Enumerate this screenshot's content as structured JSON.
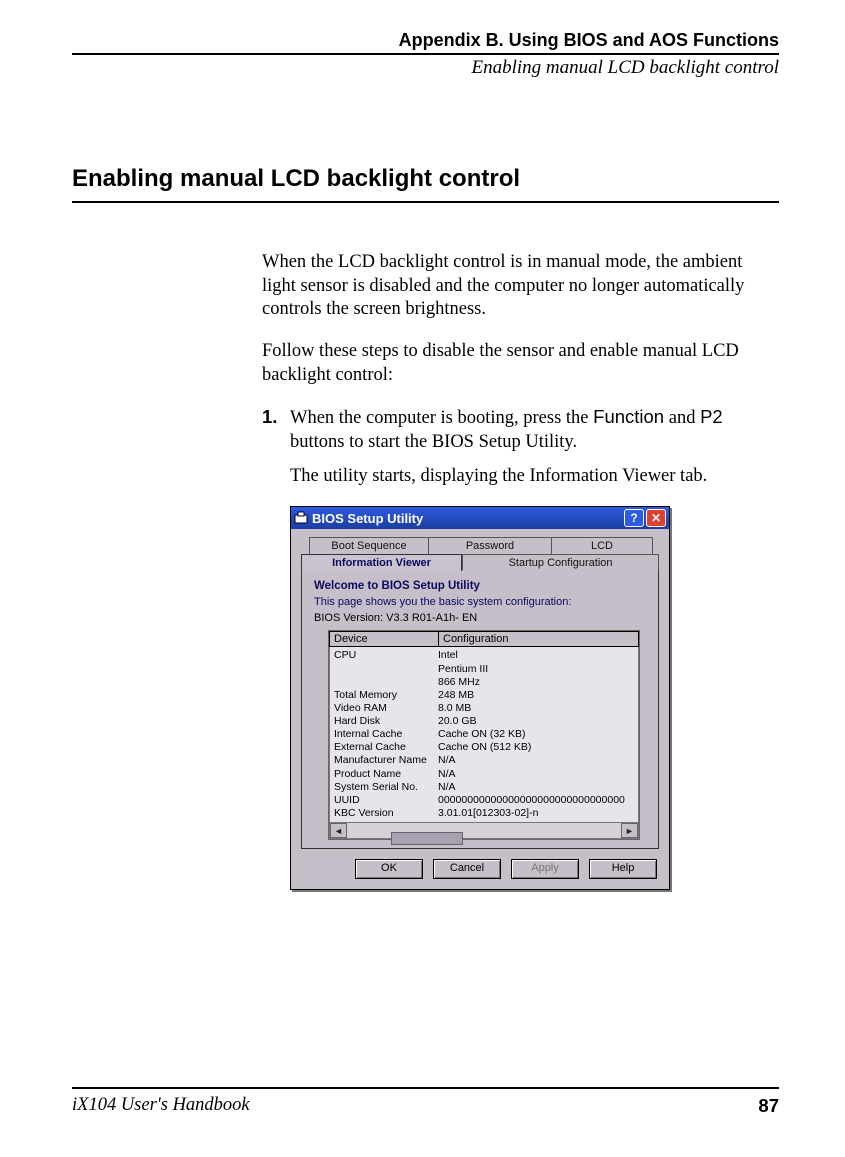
{
  "header": {
    "chapter": "Appendix B. Using BIOS and AOS Functions",
    "section": "Enabling manual LCD backlight control"
  },
  "title": "Enabling manual LCD backlight control",
  "paragraphs": {
    "p1": "When the LCD backlight control is in manual mode, the ambient light sensor is disabled and the computer no longer automatically controls the screen brightness.",
    "p2": "Follow these steps to disable the sensor and enable manual LCD backlight control:"
  },
  "step": {
    "num": "1.",
    "line_a": "When the computer is booting, press the ",
    "fn": "Function",
    "line_b": " and ",
    "p2": "P2",
    "line_c": " buttons to start the BIOS Setup Utility.",
    "line2": "The utility starts, displaying the Information Viewer tab."
  },
  "window": {
    "title": "BIOS Setup Utility",
    "help": "?",
    "close": "✕",
    "tabs": {
      "boot": "Boot Sequence",
      "password": "Password",
      "lcd": "LCD",
      "info": "Information Viewer",
      "startup": "Startup Configuration"
    },
    "panel": {
      "welcome": "Welcome to BIOS Setup Utility",
      "desc": "This page shows you the basic system configuration:",
      "bios": "BIOS Version: V3.3 R01-A1h- EN",
      "headers": {
        "device": "Device",
        "config": "Configuration"
      },
      "rows": [
        {
          "d": "CPU",
          "c": "Intel"
        },
        {
          "d": "",
          "c": "Pentium III"
        },
        {
          "d": "",
          "c": "866 MHz"
        },
        {
          "d": "Total Memory",
          "c": "248 MB"
        },
        {
          "d": "Video RAM",
          "c": "8.0 MB"
        },
        {
          "d": "Hard Disk",
          "c": "20.0 GB"
        },
        {
          "d": "Internal Cache",
          "c": "Cache ON (32 KB)"
        },
        {
          "d": "External Cache",
          "c": "Cache ON (512 KB)"
        },
        {
          "d": "Manufacturer Name",
          "c": "N/A"
        },
        {
          "d": "Product Name",
          "c": "N/A"
        },
        {
          "d": "System Serial No.",
          "c": "N/A"
        },
        {
          "d": "UUID",
          "c": "00000000000000000000000000000000"
        },
        {
          "d": "KBC Version",
          "c": "3.01.01[012303-02]-n"
        }
      ]
    },
    "buttons": {
      "ok": "OK",
      "cancel": "Cancel",
      "apply": "Apply",
      "help": "Help"
    }
  },
  "footer": {
    "book": "iX104 User's Handbook",
    "page": "87"
  }
}
